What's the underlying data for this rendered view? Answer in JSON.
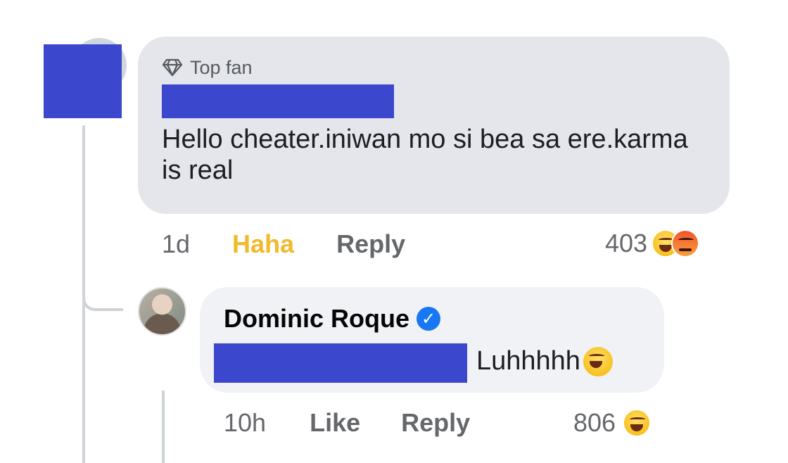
{
  "comment": {
    "badge_label": "Top fan",
    "text": "Hello cheater.iniwan mo si bea sa ere.karma is real",
    "time": "1d",
    "reaction_action": "Haha",
    "reply_action": "Reply",
    "reaction_count": "403",
    "reaction_icons": [
      "haha-icon",
      "angry-icon"
    ]
  },
  "reply": {
    "author": "Dominic Roque",
    "text": "Luhhhhh",
    "time": "10h",
    "like_action": "Like",
    "reply_action": "Reply",
    "reaction_count": "806",
    "reaction_icons": [
      "haha-icon"
    ]
  },
  "colors": {
    "redaction": "#3b47cd",
    "haha_active": "#f2b92c",
    "verified": "#1877f2",
    "bubble_top": "#e4e6eb",
    "bubble_reply": "#f0f2f5"
  }
}
